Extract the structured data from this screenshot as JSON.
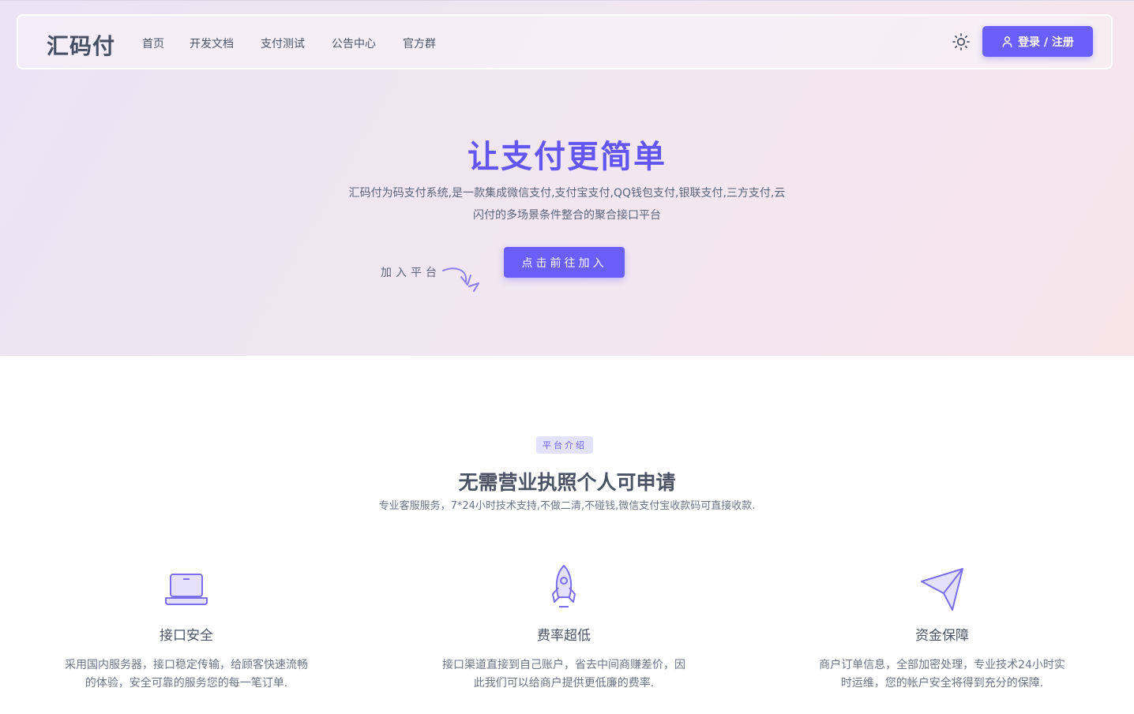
{
  "header": {
    "brand": "汇码付",
    "nav": [
      "首页",
      "开发文档",
      "支付测试",
      "公告中心",
      "官方群"
    ],
    "theme_icon": "sun-icon",
    "login_label": "登录 / 注册",
    "login_icon": "user-icon"
  },
  "hero": {
    "title": "让支付更简单",
    "description": "汇码付为码支付系统,是一款集成微信支付,支付宝支付,QQ钱包支付,银联支付,三方支付,云闪付的多场景条件整合的聚合接口平台",
    "join_label": "加入平台",
    "cta_label": "点击前往加入"
  },
  "intro": {
    "badge": "平台介绍",
    "title": "无需营业执照个人可申请",
    "subtitle": "专业客服服务，7*24小时技术支持,不做二清,不碰钱,微信支付宝收款码可直接收款."
  },
  "features": [
    {
      "icon": "laptop-icon",
      "title": "接口安全",
      "desc": "采用国内服务器，接口稳定传输，给顾客快速流畅的体验，安全可靠的服务您的每一笔订单."
    },
    {
      "icon": "rocket-icon",
      "title": "费率超低",
      "desc": "接口渠道直接到自己账户，省去中间商赚差价，因此我们可以给商户提供更低廉的费率."
    },
    {
      "icon": "paper-plane-icon",
      "title": "资金保障",
      "desc": "商户订单信息，全部加密处理，专业技术24小时实时运维，您的帐户安全将得到充分的保障."
    }
  ],
  "colors": {
    "accent": "#6a5ffa",
    "text": "#5b6478"
  }
}
